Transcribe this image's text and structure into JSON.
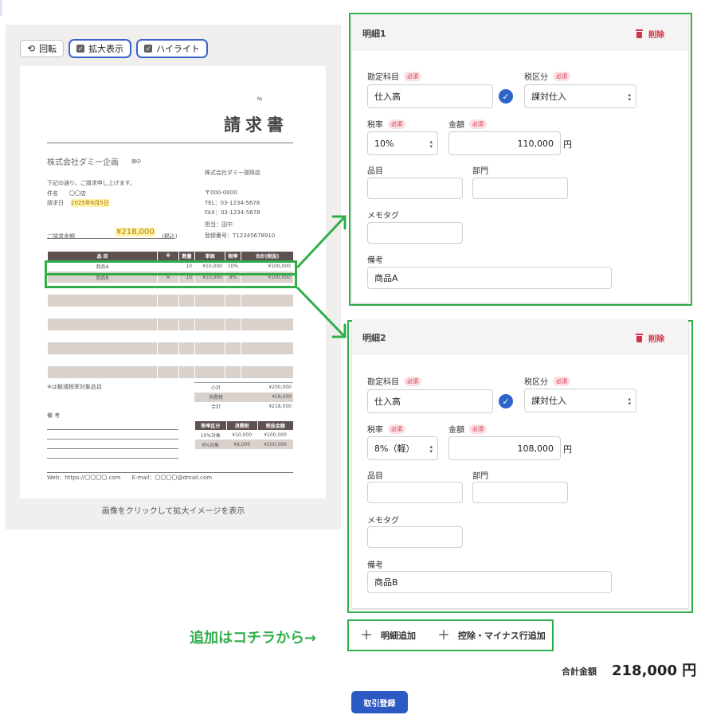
{
  "toolbar": {
    "rotate_label": "回転",
    "zoom_label": "拡大表示",
    "highlight_label": "ハイライト"
  },
  "invoice": {
    "no_label": "№",
    "title": "請求書",
    "company": "株式会社ダミー企画",
    "onchu": "御中",
    "lead_text": "下記の通り、ご請求申し上げます。",
    "subject_label": "件名",
    "subject_value": "〇〇店",
    "date_label": "請求日",
    "date_value": "2025年6月5日",
    "amount_label": "ご請求金額",
    "amount_value": "¥218,000",
    "amount_tax": "(税込)",
    "issuer": "株式会社ダミー珈琲店",
    "postal": "〒000-0000",
    "tel": "TEL：03-1234-5678",
    "fax": "FAX：03-1234-5678",
    "person": "担当：田中",
    "reg_no": "登録番号：T12345678910",
    "table_headers": [
      "品 目",
      "※",
      "数量",
      "単価",
      "税率",
      "合計(税抜)"
    ],
    "rows": [
      [
        "商品A",
        "",
        "10",
        "¥10,000",
        "10%",
        "¥100,000"
      ],
      [
        "商品B",
        "※",
        "10",
        "¥10,000",
        "8%",
        "¥100,000"
      ]
    ],
    "reduced_note": "※は軽減税率対象品目",
    "subtotal_label": "小計",
    "subtotal_value": "¥200,000",
    "tax_label": "消費税",
    "tax_value": "¥18,000",
    "total_label": "合計",
    "total_value": "¥218,000",
    "bikou_label": "備 考",
    "tax_headers": [
      "税率区分",
      "消費税",
      "税抜金額"
    ],
    "tax_rows": [
      [
        "10%対象",
        "¥10,000",
        "¥100,000"
      ],
      [
        "8%対象",
        "¥8,000",
        "¥100,000"
      ]
    ],
    "footer": "Web：https://〇〇〇〇.com　　E-mail：〇〇〇〇@dmail.com"
  },
  "preview_caption": "画像をクリックして拡大イメージを表示",
  "field_labels": {
    "account": "勘定科目",
    "tax_class": "税区分",
    "rate": "税率",
    "amount": "金額",
    "item": "品目",
    "dept": "部門",
    "memo": "メモタグ",
    "remarks": "備考",
    "required": "必須",
    "delete": "削除",
    "yen": "円"
  },
  "details": [
    {
      "title": "明細1",
      "account": "仕入高",
      "tax_class": "課対仕入",
      "rate": "10%",
      "amount": "110,000",
      "remarks": "商品A"
    },
    {
      "title": "明細2",
      "account": "仕入高",
      "tax_class": "課対仕入",
      "rate": "8%（軽）",
      "amount": "108,000",
      "remarks": "商品B"
    }
  ],
  "add_note": "追加はコチラから→",
  "add_detail_label": "明細追加",
  "add_deduction_label": "控除・マイナス行追加",
  "total_label": "合計金額",
  "total_value": "218,000 円",
  "submit_label": "取引登録",
  "colors": {
    "accent_green": "#2fae4a",
    "primary_blue": "#2b5ac3",
    "danger": "#d33347"
  }
}
